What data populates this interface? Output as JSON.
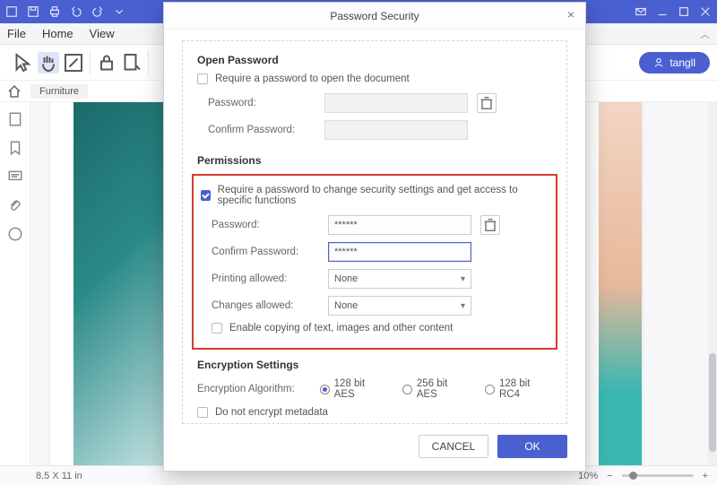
{
  "menubar": {
    "file": "File",
    "home": "Home",
    "view": "View"
  },
  "user": {
    "name": "tangll"
  },
  "breadcrumb": {
    "item": "Furniture"
  },
  "status": {
    "page_size": "8.5 X 11 in",
    "zoom": "10%",
    "minus": "−",
    "plus": "+"
  },
  "dialog": {
    "title": "Password Security",
    "open_pw": {
      "section": "Open Password",
      "require": "Require a password to open the document",
      "password": "Password:",
      "confirm": "Confirm Password:"
    },
    "perm": {
      "section": "Permissions",
      "require": "Require a password to change security settings and get access to specific functions",
      "password": "Password:",
      "confirm": "Confirm Password:",
      "pw_value": "******",
      "cpw_value": "******",
      "printing": "Printing allowed:",
      "changes": "Changes allowed:",
      "none": "None",
      "copy": "Enable copying of text, images and other content"
    },
    "enc": {
      "section": "Encryption Settings",
      "algo": "Encryption Algorithm:",
      "o1": "128 bit AES",
      "o2": "256 bit AES",
      "o3": "128 bit RC4",
      "meta": "Do not encrypt metadata"
    },
    "cancel": "CANCEL",
    "ok": "OK"
  }
}
